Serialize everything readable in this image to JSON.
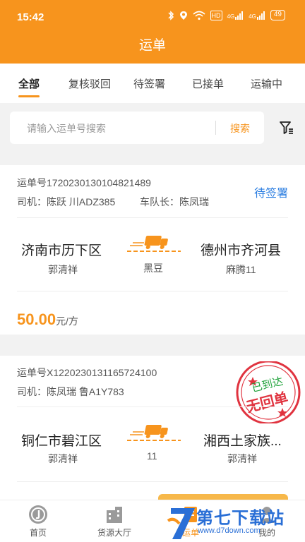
{
  "status_bar": {
    "time": "15:42",
    "hd_label": "HD",
    "signal1_label": "4G",
    "signal2_label": "4G",
    "battery": "49"
  },
  "title": "运单",
  "tabs": [
    "全部",
    "复核驳回",
    "待签署",
    "已接单",
    "运输中"
  ],
  "search": {
    "placeholder": "请输入运单号搜索",
    "button": "搜索"
  },
  "orders": [
    {
      "number_line": "运单号1720230130104821489",
      "driver_line": "司机：陈跃  川ADZ385",
      "captain_line": "车队长：陈凤瑞",
      "status": "待签署",
      "from_city": "济南市历下区",
      "from_person": "郭清祥",
      "cargo": "黑豆",
      "to_city": "德州市齐河县",
      "to_person": "麻腾11",
      "price": "50.00",
      "price_unit": "元/方"
    },
    {
      "number_line": "运单号X1220230131165724100",
      "driver_line": "司机：陈凤瑞  鲁A1Y783",
      "stamp_top": "已到达",
      "stamp_bottom": "无回单",
      "from_city": "铜仁市碧江区",
      "from_person": "郭清祥",
      "cargo": "11",
      "to_city": "湘西土家族...",
      "to_person": "郭清祥"
    }
  ],
  "bottom_nav": [
    {
      "label": "首页",
      "icon": "home-icon"
    },
    {
      "label": "货源大厅",
      "icon": "building-icon"
    },
    {
      "label": "运单",
      "icon": "waybill-icon"
    },
    {
      "label": "我的",
      "icon": "user-icon"
    }
  ],
  "watermark": {
    "title": "第七下载站",
    "url": "www.d7down.com"
  },
  "colors": {
    "brand": "#f7941d",
    "status_blue": "#2a7de1",
    "stamp_red": "#e0333f",
    "stamp_green": "#1fa23a"
  }
}
